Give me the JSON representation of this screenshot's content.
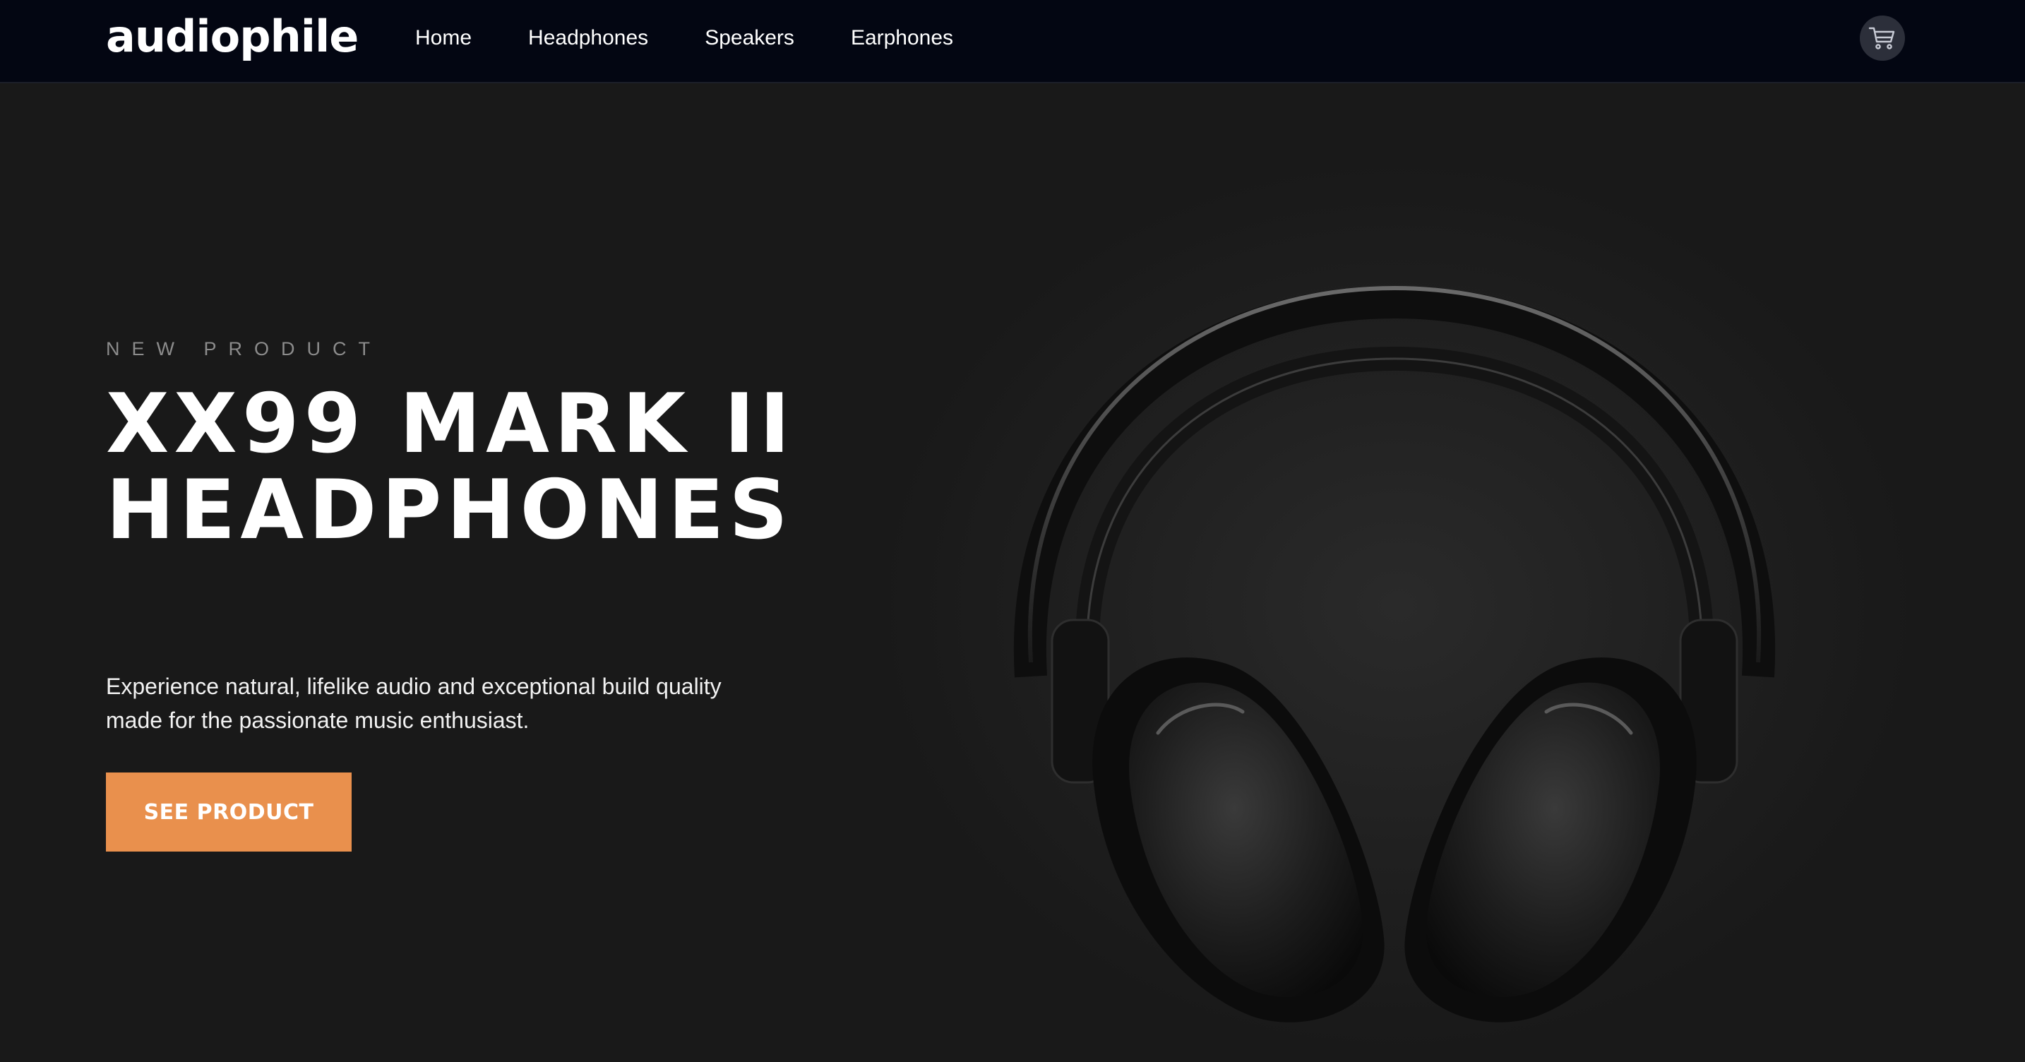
{
  "nav": {
    "logo": "audiophile",
    "links": [
      "Home",
      "Headphones",
      "Speakers",
      "Earphones"
    ],
    "cart_icon": "shopping-cart-icon"
  },
  "hero": {
    "overline": "NEW PRODUCT",
    "title_line1": "XX99 MARK II",
    "title_line2": "HEADPHONES",
    "description": "Experience natural, lifelike audio and exceptional build quality made for the passionate music enthusiast.",
    "cta_label": "SEE PRODUCT",
    "image": "over-ear-headphones-image"
  },
  "colors": {
    "navbar_bg": "#030612",
    "hero_bg": "#191919",
    "accent": "#E9904D",
    "text": "#FFFFFF",
    "muted": "#8C8C8C"
  }
}
